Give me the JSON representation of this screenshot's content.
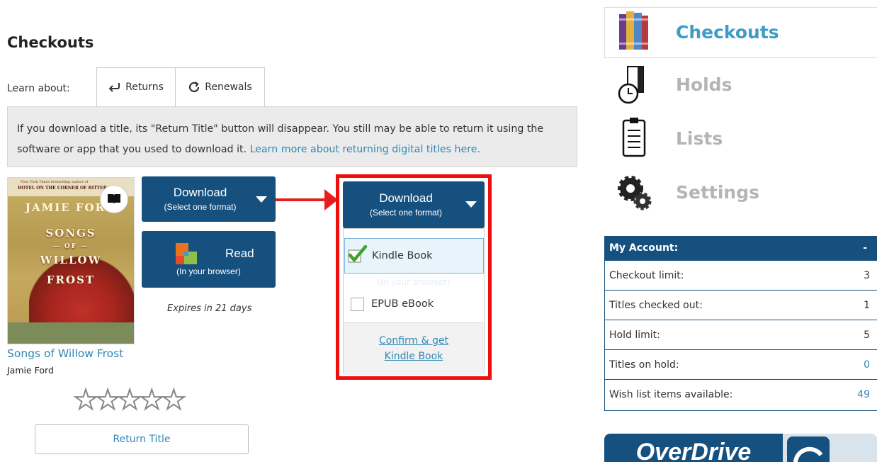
{
  "page": {
    "title": "Checkouts"
  },
  "learn": {
    "label": "Learn about:",
    "tabs": [
      {
        "label": "Returns"
      },
      {
        "label": "Renewals"
      }
    ],
    "info_text": "If you download a title, its \"Return Title\" button will disappear. You still may be able to return it using the software or app that you used to download it. ",
    "info_link": "Learn more about returning digital titles here."
  },
  "book": {
    "title": "Songs of Willow Frost",
    "author": "Jamie Ford",
    "cover": {
      "top_line": "New York Times bestselling author of",
      "top_title": "HOTEL ON THE CORNER OF BITTER",
      "author": "JAMIE FORD",
      "title_lines": [
        "SONGS",
        "— OF —",
        "WILLOW",
        "FROST"
      ]
    },
    "expires": "Expires in 21 days",
    "return_label": "Return Title",
    "rating_stars": "★★★★★"
  },
  "download_button": {
    "label": "Download",
    "sub": "(Select one format)"
  },
  "read_button": {
    "label": "Read",
    "sub": "(In your browser)"
  },
  "dropdown": {
    "button_label": "Download",
    "button_sub": "(Select one format)",
    "ghost_text": "(In your browser)",
    "options": [
      {
        "label": "Kindle Book",
        "checked": true
      },
      {
        "label": "EPUB eBook",
        "checked": false
      }
    ],
    "confirm_line1": "Confirm & get",
    "confirm_line2": "Kindle Book"
  },
  "nav": {
    "items": [
      {
        "label": "Checkouts",
        "icon": "books-icon",
        "active": true
      },
      {
        "label": "Holds",
        "icon": "clock-book-icon",
        "active": false
      },
      {
        "label": "Lists",
        "icon": "clipboard-icon",
        "active": false
      },
      {
        "label": "Settings",
        "icon": "gears-icon",
        "active": false
      }
    ]
  },
  "account": {
    "header": "My Account:",
    "toggle": "-",
    "rows": [
      {
        "label": "Checkout limit:",
        "value": "3"
      },
      {
        "label": "Titles checked out:",
        "value": "1"
      },
      {
        "label": "Hold limit:",
        "value": "5"
      },
      {
        "label": "Titles on hold:",
        "value": "0"
      },
      {
        "label": "Wish list items available:",
        "value": "49"
      }
    ]
  },
  "banner": {
    "logo_text": "OverDrive"
  },
  "colors": {
    "brand_blue": "#16507f",
    "link_blue": "#2f88b5",
    "highlight_red": "#ee0f0f"
  }
}
